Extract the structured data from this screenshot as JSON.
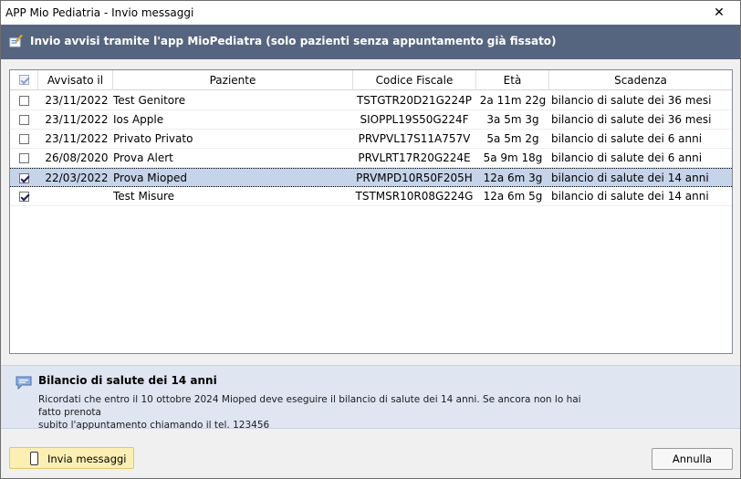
{
  "window": {
    "title": "APP Mio Pediatria - Invio messaggi",
    "close_glyph": "✕"
  },
  "header": {
    "text": "Invio avvisi tramite l'app MioPediatra  (solo pazienti senza appuntamento già fissato)",
    "icon": "send-message-icon"
  },
  "table": {
    "columns": [
      "Avvisato il",
      "Paziente",
      "Codice Fiscale",
      "Età",
      "Scadenza"
    ],
    "rows": [
      {
        "checked": false,
        "date": "23/11/2022",
        "patient": "Test Genitore",
        "cf": "TSTGTR20D21G224P",
        "age": "2a 11m 22g",
        "due": "bilancio di salute dei 36 mesi",
        "selected": false
      },
      {
        "checked": false,
        "date": "23/11/2022",
        "patient": "Ios Apple",
        "cf": "SIOPPL19S50G224F",
        "age": "3a 5m 3g",
        "due": "bilancio di salute dei 36 mesi",
        "selected": false
      },
      {
        "checked": false,
        "date": "23/11/2022",
        "patient": "Privato Privato",
        "cf": "PRVPVL17S11A757V",
        "age": "5a 5m 2g",
        "due": "bilancio di salute dei 6 anni",
        "selected": false
      },
      {
        "checked": false,
        "date": "26/08/2020",
        "patient": "Prova Alert",
        "cf": "PRVLRT17R20G224E",
        "age": "5a 9m 18g",
        "due": "bilancio di salute dei 6 anni",
        "selected": false
      },
      {
        "checked": true,
        "date": "22/03/2022",
        "patient": "Prova Mioped",
        "cf": "PRVMPD10R50F205H",
        "age": "12a 6m 3g",
        "due": "bilancio di salute dei 14 anni",
        "selected": true
      },
      {
        "checked": true,
        "date": "",
        "patient": "Test Misure",
        "cf": "TSTMSR10R08G224G",
        "age": "12a 6m 5g",
        "due": "bilancio di salute dei 14 anni",
        "selected": false
      }
    ]
  },
  "info": {
    "title": "Bilancio di salute dei 14 anni",
    "line1": "Ricordati che entro il 10 ottobre 2024 Mioped deve eseguire il bilancio di salute dei 14 anni. Se ancora non lo hai fatto prenota",
    "line2": "subito l'appuntamento chiamando il tel. 123456",
    "icon": "speech-bubble-icon"
  },
  "buttons": {
    "send_label": "Invia messaggi",
    "cancel_label": "Annulla"
  },
  "colors": {
    "header_bg": "#56657f",
    "info_bg": "#dfe6f2",
    "selected_row": "#c6d4ea",
    "send_button": "#fcefb4"
  }
}
